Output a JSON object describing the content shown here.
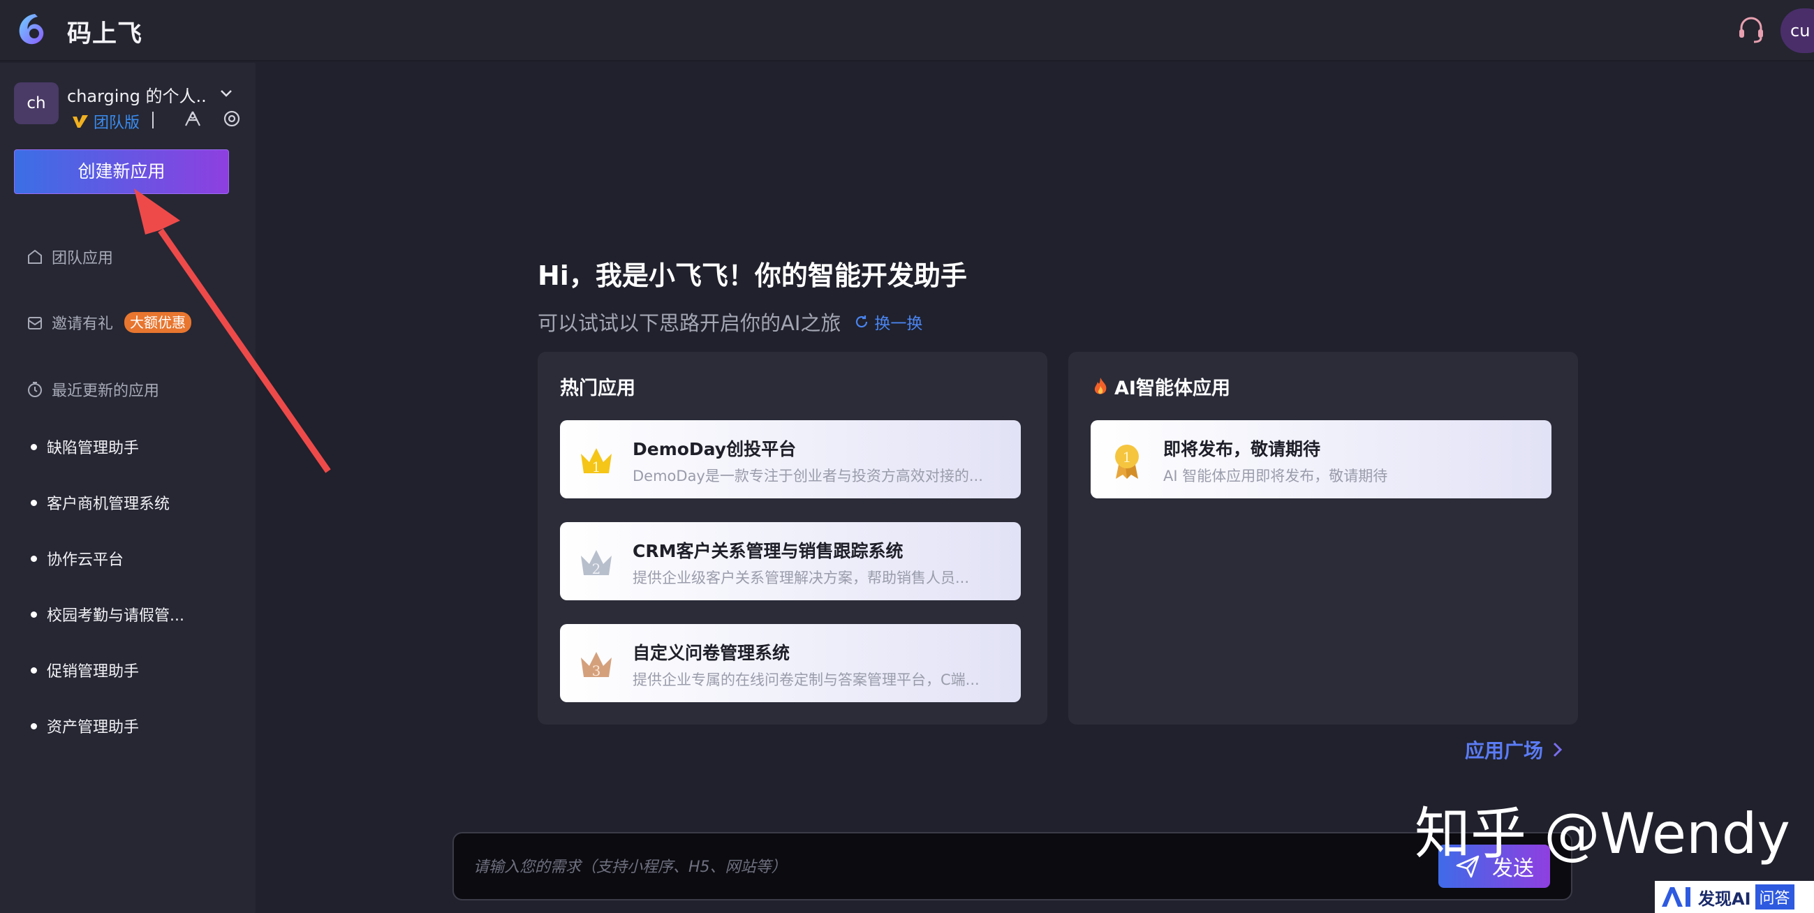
{
  "header": {
    "app_name": "码上飞",
    "user_avatar": "cu",
    "icons": [
      "app-logo-icon",
      "support-headset-icon"
    ]
  },
  "sidebar": {
    "workspace": {
      "avatar": "ch",
      "name": "charging 的个人...",
      "plan": "团队版"
    },
    "create_button": "创建新应用",
    "nav": {
      "team_apps": "团队应用",
      "invite": "邀请有礼",
      "invite_badge": "大额优惠",
      "recent": "最近更新的应用"
    },
    "recent_apps": [
      "缺陷管理助手",
      "客户商机管理系统",
      "协作云平台",
      "校园考勤与请假管...",
      "促销管理助手",
      "资产管理助手"
    ]
  },
  "main": {
    "greeting": "Hi，我是小飞飞！你的智能开发助手",
    "subtitle": "可以试试以下思路开启你的AI之旅",
    "refresh": "换一换",
    "hot_panel": {
      "title": "热门应用",
      "cards": [
        {
          "title": "DemoDay创投平台",
          "desc": "DemoDay是一款专注于创业者与投资方高效对接的...",
          "rank": "1"
        },
        {
          "title": "CRM客户关系管理与销售跟踪系统",
          "desc": "提供企业级客户关系管理解决方案，帮助销售人员...",
          "rank": "2"
        },
        {
          "title": "自定义问卷管理系统",
          "desc": "提供企业专属的在线问卷定制与答案管理平台，C端...",
          "rank": "3"
        }
      ]
    },
    "ai_panel": {
      "title": "AI智能体应用",
      "cards": [
        {
          "title": "即将发布，敬请期待",
          "desc": "AI 智能体应用即将发布，敬请期待",
          "rank": "1"
        }
      ]
    },
    "plaza_link": "应用广场",
    "input": {
      "placeholder": "请输入您的需求（支持小程序、H5、网站等）",
      "send": "发送"
    }
  },
  "watermarks": {
    "zhihu": "知乎 @Wendy",
    "site_name": "发现AI",
    "site_tag": "问答"
  },
  "colors": {
    "accent_start": "#3b6fe6",
    "accent_end": "#8e3fe0",
    "link_blue": "#4a84f0",
    "promo_orange": "#e8762f",
    "arrow_red": "#ee4a4a"
  }
}
